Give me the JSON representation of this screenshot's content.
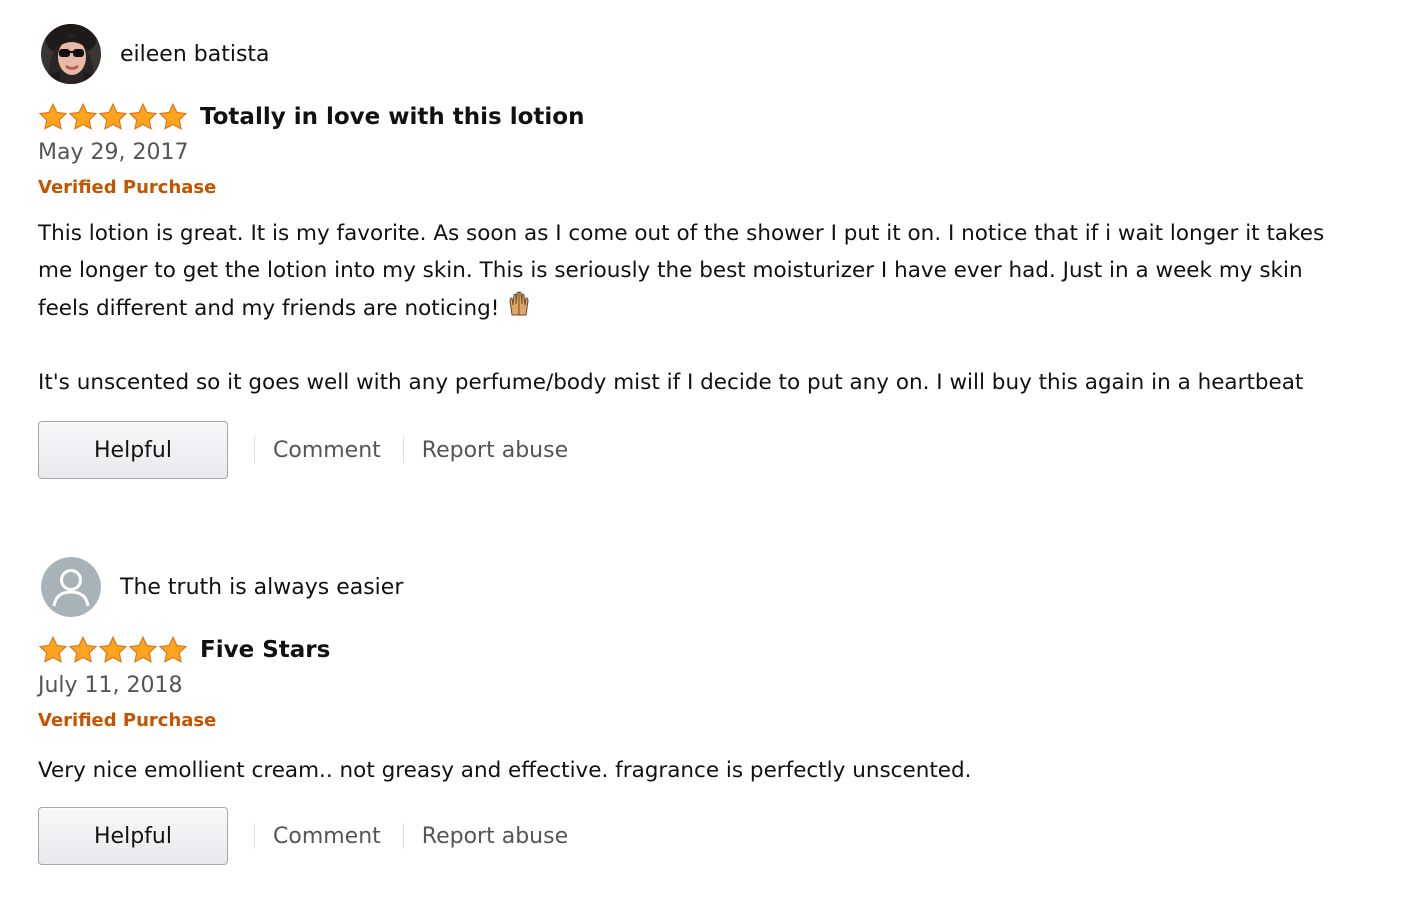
{
  "reviews": [
    {
      "profile_name": "eileen batista",
      "avatar": "profile-photo",
      "rating": 5,
      "rating_max": 5,
      "title": "Totally in love with this lotion",
      "date": "May 29, 2017",
      "badge": "Verified Purchase",
      "body": [
        "This lotion is great. It is my favorite. As soon as I come out of the shower I put it on. I notice that if i wait longer it takes me longer to get the lotion into my skin. This is seriously the best moisturizer I have ever had. Just in a week my skin feels different and my friends are noticing!",
        "It's unscented so it goes well with any perfume/body mist if I decide to put any on. I will buy this again in a heartbeat"
      ],
      "body_emoji": "raising-hands-emoji",
      "helpful_label": "Helpful",
      "comment_label": "Comment",
      "report_label": "Report abuse"
    },
    {
      "profile_name": "The truth is always easier",
      "avatar": "default-user-icon",
      "rating": 5,
      "rating_max": 5,
      "title": "Five Stars",
      "date": "July 11, 2018",
      "badge": "Verified Purchase",
      "body": [
        "Very nice emollient cream.. not greasy and effective. fragrance is perfectly unscented."
      ],
      "helpful_label": "Helpful",
      "comment_label": "Comment",
      "report_label": "Report abuse"
    }
  ],
  "colors": {
    "star": "#ffa41c",
    "star_outline": "#de7921",
    "verified": "#c45500",
    "link": "#555555",
    "text": "#111111"
  }
}
